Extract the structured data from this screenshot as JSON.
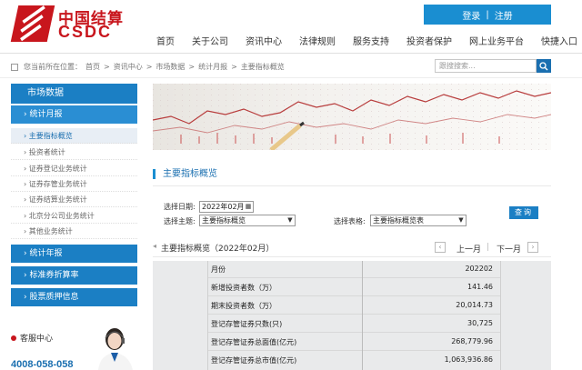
{
  "brand": {
    "cn": "中国结算",
    "en": "CSDC"
  },
  "auth": {
    "login": "登录",
    "sep": "|",
    "register": "注册"
  },
  "nav": [
    "首页",
    "关于公司",
    "资讯中心",
    "法律规则",
    "服务支持",
    "投资者保护",
    "网上业务平台",
    "快捷入口"
  ],
  "breadcrumb": {
    "prefix": "您当前所在位置：",
    "items": [
      "首页",
      "资讯中心",
      "市场数据",
      "统计月报",
      "主要指标概览"
    ],
    "sep": ">"
  },
  "search": {
    "placeholder": "跟搜搜索..."
  },
  "sidebar": {
    "title": "市场数据",
    "section1": "统计月报",
    "items": [
      "主要指标概览",
      "投资者统计",
      "证券登记业务统计",
      "证券存管业务统计",
      "证券结算业务统计",
      "北京分公司业务统计",
      "其他业务统计"
    ],
    "blocks": [
      "统计年报",
      "标准券折算率",
      "股票质押信息"
    ],
    "service": "客服中心",
    "phone": "4008-058-058"
  },
  "main": {
    "section_title": "主要指标概览",
    "form": {
      "date_label": "选择日期:",
      "date_value": "2022年02月",
      "topic_label": "选择主题:",
      "topic_value": "主要指标概览",
      "table_label": "选择表格:",
      "table_value": "主要指标概览表",
      "query": "查询"
    },
    "summary_title": "主要指标概览（2022年02月）",
    "pager": {
      "prev_icon": "‹",
      "prev": "上一月",
      "sep": "|",
      "next": "下一月",
      "next_icon": "›"
    },
    "table": [
      {
        "k": "月份",
        "v": "202202"
      },
      {
        "k": "新增投资者数（万）",
        "v": "141.46"
      },
      {
        "k": "期末投资者数（万）",
        "v": "20,014.73"
      },
      {
        "k": "登记存管证券只数(只)",
        "v": "30,725"
      },
      {
        "k": "登记存管证券总面值(亿元)",
        "v": "268,779.96"
      },
      {
        "k": "登记存管证券总市值(亿元)",
        "v": "1,063,936.86"
      }
    ]
  },
  "colors": {
    "brand_red": "#c8161d",
    "primary_blue": "#1b7fc4",
    "accent_blue": "#1a8ed1"
  }
}
